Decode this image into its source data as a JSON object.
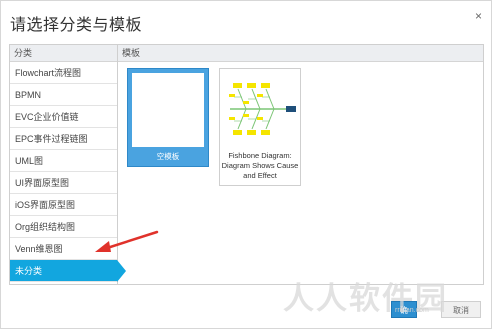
{
  "dialog": {
    "title": "请选择分类与模板",
    "close_label": "×"
  },
  "categories": {
    "header": "分类",
    "items": [
      {
        "label": "Flowchart流程图"
      },
      {
        "label": "BPMN"
      },
      {
        "label": "EVC企业价值链"
      },
      {
        "label": "EPC事件过程链图"
      },
      {
        "label": "UML图"
      },
      {
        "label": "UI界面原型图"
      },
      {
        "label": "iOS界面原型图"
      },
      {
        "label": "Org组织结构图"
      },
      {
        "label": "Venn维恩图"
      },
      {
        "label": "未分类"
      }
    ],
    "active_index": 9
  },
  "templates": {
    "header": "模板",
    "items": [
      {
        "label": "空模板"
      },
      {
        "label": "Fishbone Diagram: Diagram Shows Cause and Effect"
      }
    ]
  },
  "footer": {
    "ok_label": "确",
    "cancel_label": "取消"
  },
  "watermark": {
    "text": "人人软件园",
    "subtext": "rrruan.com"
  },
  "colors": {
    "accent": "#12a6df",
    "selected_card": "#4aa3e0",
    "arrow": "#e0322b",
    "fishbone_box": "#f5e500",
    "fishbone_line": "#7cc576",
    "fishbone_head": "#1f4f7a"
  }
}
